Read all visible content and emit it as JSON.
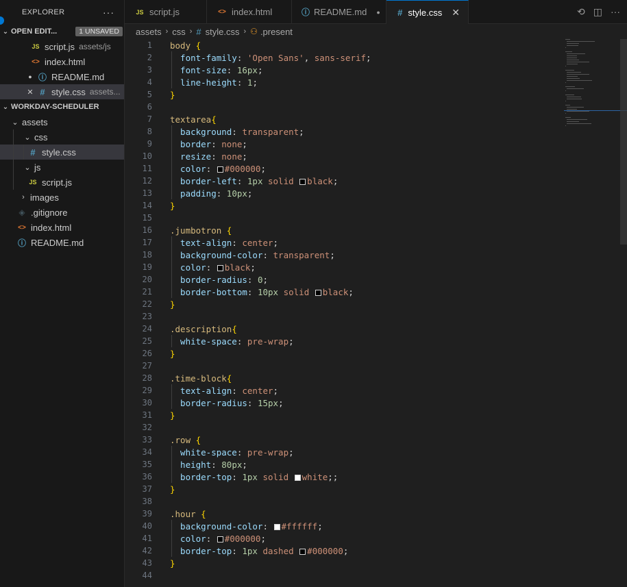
{
  "sidebar": {
    "title": "EXPLORER",
    "more_icon": "ellipsis-icon",
    "open_editors": {
      "label": "OPEN EDIT...",
      "badge": "1 UNSAVED",
      "items": [
        {
          "name": "script.js",
          "desc": "assets/js",
          "icon": "js-file-icon"
        },
        {
          "name": "index.html",
          "desc": "",
          "icon": "html-file-icon"
        },
        {
          "name": "README.md",
          "desc": "",
          "icon": "info-file-icon"
        },
        {
          "name": "style.css",
          "desc": "assets...",
          "icon": "css-file-icon"
        }
      ]
    },
    "project": {
      "label": "WORKDAY-SCHEDULER",
      "tree": [
        {
          "name": "assets"
        },
        {
          "name": "css"
        },
        {
          "name": "style.css"
        },
        {
          "name": "js"
        },
        {
          "name": "script.js"
        },
        {
          "name": "images"
        },
        {
          "name": ".gitignore"
        },
        {
          "name": "index.html"
        },
        {
          "name": "README.md"
        }
      ]
    }
  },
  "tabs": [
    {
      "label": "script.js"
    },
    {
      "label": "index.html"
    },
    {
      "label": "README.md"
    },
    {
      "label": "style.css"
    }
  ],
  "breadcrumb": [
    "assets",
    "css",
    "style.css",
    ".present"
  ],
  "editor": {
    "lines": [
      {
        "n": "1",
        "tokens": [
          [
            "sel",
            "body "
          ],
          [
            "brace",
            "{"
          ]
        ]
      },
      {
        "n": "2",
        "tokens": [
          [
            "prop",
            "  font-family"
          ],
          [
            "punc",
            ": "
          ],
          [
            "str",
            "'Open Sans'"
          ],
          [
            "punc",
            ", "
          ],
          [
            "val",
            "sans-serif"
          ],
          [
            "punc",
            ";"
          ]
        ]
      },
      {
        "n": "3",
        "tokens": [
          [
            "prop",
            "  font-size"
          ],
          [
            "punc",
            ": "
          ],
          [
            "num",
            "16px"
          ],
          [
            "punc",
            ";"
          ]
        ]
      },
      {
        "n": "4",
        "tokens": [
          [
            "prop",
            "  line-height"
          ],
          [
            "punc",
            ": "
          ],
          [
            "num",
            "1"
          ],
          [
            "punc",
            ";"
          ]
        ]
      },
      {
        "n": "5",
        "tokens": [
          [
            "brace",
            "}"
          ]
        ]
      },
      {
        "n": "6",
        "tokens": []
      },
      {
        "n": "7",
        "tokens": [
          [
            "sel",
            "textarea"
          ],
          [
            "brace",
            "{"
          ]
        ]
      },
      {
        "n": "8",
        "tokens": [
          [
            "prop",
            "  background"
          ],
          [
            "punc",
            ": "
          ],
          [
            "val",
            "transparent"
          ],
          [
            "punc",
            ";"
          ]
        ]
      },
      {
        "n": "9",
        "tokens": [
          [
            "prop",
            "  border"
          ],
          [
            "punc",
            ": "
          ],
          [
            "val",
            "none"
          ],
          [
            "punc",
            ";"
          ]
        ]
      },
      {
        "n": "10",
        "tokens": [
          [
            "prop",
            "  resize"
          ],
          [
            "punc",
            ": "
          ],
          [
            "val",
            "none"
          ],
          [
            "punc",
            ";"
          ]
        ]
      },
      {
        "n": "11",
        "tokens": [
          [
            "prop",
            "  color"
          ],
          [
            "punc",
            ": "
          ],
          [
            "swatch",
            "#000000"
          ],
          [
            "val",
            "#000000"
          ],
          [
            "punc",
            ";"
          ]
        ]
      },
      {
        "n": "12",
        "tokens": [
          [
            "prop",
            "  border-left"
          ],
          [
            "punc",
            ": "
          ],
          [
            "num",
            "1px"
          ],
          [
            "val",
            " solid "
          ],
          [
            "swatch",
            "#000000"
          ],
          [
            "val",
            "black"
          ],
          [
            "punc",
            ";"
          ]
        ]
      },
      {
        "n": "13",
        "tokens": [
          [
            "prop",
            "  padding"
          ],
          [
            "punc",
            ": "
          ],
          [
            "num",
            "10px"
          ],
          [
            "punc",
            ";"
          ]
        ]
      },
      {
        "n": "14",
        "tokens": [
          [
            "brace",
            "}"
          ]
        ]
      },
      {
        "n": "15",
        "tokens": []
      },
      {
        "n": "16",
        "tokens": [
          [
            "sel",
            ".jumbotron "
          ],
          [
            "brace",
            "{"
          ]
        ]
      },
      {
        "n": "17",
        "tokens": [
          [
            "prop",
            "  text-align"
          ],
          [
            "punc",
            ": "
          ],
          [
            "val",
            "center"
          ],
          [
            "punc",
            ";"
          ]
        ]
      },
      {
        "n": "18",
        "tokens": [
          [
            "prop",
            "  background-color"
          ],
          [
            "punc",
            ": "
          ],
          [
            "val",
            "transparent"
          ],
          [
            "punc",
            ";"
          ]
        ]
      },
      {
        "n": "19",
        "tokens": [
          [
            "prop",
            "  color"
          ],
          [
            "punc",
            ": "
          ],
          [
            "swatch",
            "#000000"
          ],
          [
            "val",
            "black"
          ],
          [
            "punc",
            ";"
          ]
        ]
      },
      {
        "n": "20",
        "tokens": [
          [
            "prop",
            "  border-radius"
          ],
          [
            "punc",
            ": "
          ],
          [
            "num",
            "0"
          ],
          [
            "punc",
            ";"
          ]
        ]
      },
      {
        "n": "21",
        "tokens": [
          [
            "prop",
            "  border-bottom"
          ],
          [
            "punc",
            ": "
          ],
          [
            "num",
            "10px"
          ],
          [
            "val",
            " solid "
          ],
          [
            "swatch",
            "#000000"
          ],
          [
            "val",
            "black"
          ],
          [
            "punc",
            ";"
          ]
        ]
      },
      {
        "n": "22",
        "tokens": [
          [
            "brace",
            "}"
          ]
        ]
      },
      {
        "n": "23",
        "tokens": []
      },
      {
        "n": "24",
        "tokens": [
          [
            "sel",
            ".description"
          ],
          [
            "brace",
            "{"
          ]
        ]
      },
      {
        "n": "25",
        "tokens": [
          [
            "prop",
            "  white-space"
          ],
          [
            "punc",
            ": "
          ],
          [
            "val",
            "pre-wrap"
          ],
          [
            "punc",
            ";"
          ]
        ]
      },
      {
        "n": "26",
        "tokens": [
          [
            "brace",
            "}"
          ]
        ]
      },
      {
        "n": "27",
        "tokens": []
      },
      {
        "n": "28",
        "tokens": [
          [
            "sel",
            ".time-block"
          ],
          [
            "brace",
            "{"
          ]
        ]
      },
      {
        "n": "29",
        "tokens": [
          [
            "prop",
            "  text-align"
          ],
          [
            "punc",
            ": "
          ],
          [
            "val",
            "center"
          ],
          [
            "punc",
            ";"
          ]
        ]
      },
      {
        "n": "30",
        "tokens": [
          [
            "prop",
            "  border-radius"
          ],
          [
            "punc",
            ": "
          ],
          [
            "num",
            "15px"
          ],
          [
            "punc",
            ";"
          ]
        ]
      },
      {
        "n": "31",
        "tokens": [
          [
            "brace",
            "}"
          ]
        ]
      },
      {
        "n": "32",
        "tokens": []
      },
      {
        "n": "33",
        "tokens": [
          [
            "sel",
            ".row "
          ],
          [
            "brace",
            "{"
          ]
        ]
      },
      {
        "n": "34",
        "tokens": [
          [
            "prop",
            "  white-space"
          ],
          [
            "punc",
            ": "
          ],
          [
            "val",
            "pre-wrap"
          ],
          [
            "punc",
            ";"
          ]
        ]
      },
      {
        "n": "35",
        "tokens": [
          [
            "prop",
            "  height"
          ],
          [
            "punc",
            ": "
          ],
          [
            "num",
            "80px"
          ],
          [
            "punc",
            ";"
          ]
        ]
      },
      {
        "n": "36",
        "tokens": [
          [
            "prop",
            "  border-top"
          ],
          [
            "punc",
            ": "
          ],
          [
            "num",
            "1px"
          ],
          [
            "val",
            " solid "
          ],
          [
            "swatch",
            "#ffffff"
          ],
          [
            "val",
            "white"
          ],
          [
            "punc",
            ";;"
          ]
        ]
      },
      {
        "n": "37",
        "tokens": [
          [
            "brace",
            "}"
          ]
        ]
      },
      {
        "n": "38",
        "tokens": []
      },
      {
        "n": "39",
        "tokens": [
          [
            "sel",
            ".hour "
          ],
          [
            "brace",
            "{"
          ]
        ]
      },
      {
        "n": "40",
        "tokens": [
          [
            "prop",
            "  background-color"
          ],
          [
            "punc",
            ": "
          ],
          [
            "swatch",
            "#ffffff"
          ],
          [
            "val",
            "#ffffff"
          ],
          [
            "punc",
            ";"
          ]
        ]
      },
      {
        "n": "41",
        "tokens": [
          [
            "prop",
            "  color"
          ],
          [
            "punc",
            ": "
          ],
          [
            "swatch",
            "#000000"
          ],
          [
            "val",
            "#000000"
          ],
          [
            "punc",
            ";"
          ]
        ]
      },
      {
        "n": "42",
        "tokens": [
          [
            "prop",
            "  border-top"
          ],
          [
            "punc",
            ": "
          ],
          [
            "num",
            "1px"
          ],
          [
            "val",
            " dashed "
          ],
          [
            "swatch",
            "#000000"
          ],
          [
            "val",
            "#000000"
          ],
          [
            "punc",
            ";"
          ]
        ]
      },
      {
        "n": "43",
        "tokens": [
          [
            "brace",
            "}"
          ]
        ]
      },
      {
        "n": "44",
        "tokens": []
      }
    ]
  },
  "colors": {
    "accent": "#0078d4",
    "selector": "#d7ba7d",
    "property": "#9cdcfe",
    "value": "#ce9178",
    "number": "#b5cea8"
  }
}
